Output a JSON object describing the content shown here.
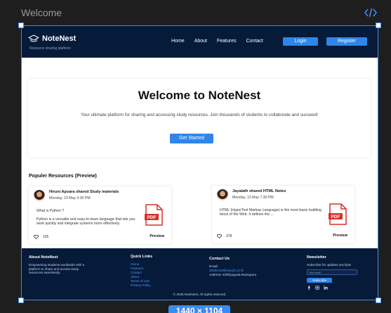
{
  "frame": {
    "title": "Welcome",
    "size_label": "1440 × 1104"
  },
  "nav": {
    "brand": "NoteNest",
    "tagline": "Resource sharing platform",
    "links": [
      "Home",
      "About",
      "Features",
      "Contact"
    ],
    "login": "Login",
    "register": "Register"
  },
  "hero": {
    "title": "Welcome to NoteNest",
    "subtitle": "Your ultimate platform for sharing and accessing study resources. Join thousands of students to collaborate and succeed!",
    "cta": "Get Started"
  },
  "resources": {
    "title": "Populer Resources (Preview)",
    "cards": [
      {
        "user": "Hiruni Apsara shared Study materials",
        "date": "Monday, 23 May 3:30 PM",
        "body": [
          "What is Python ?",
          "Python is a versatile and easy-to-learn language that lets you work quickly and integrate systems more effectively."
        ],
        "likes": "155",
        "preview": "Preview"
      },
      {
        "user": "Jayalath shared HTML Notes",
        "date": "Monday, 13 May 7:30 PM",
        "body": [
          "HTML (HyperText Markup Language) is the most basic building block of the Web. It defines the ..."
        ],
        "likes": "378",
        "preview": "Preview"
      }
    ]
  },
  "footer": {
    "about": {
      "title": "About NoteNest",
      "text": "Empowering students worldwide with a platform to share and access study resources seamlessly."
    },
    "quick_links": {
      "title": "Quick Links",
      "links": [
        "Home",
        "Features",
        "Contact",
        "About",
        "Terms of Use",
        "Privacy Policy"
      ]
    },
    "contact": {
      "title": "Contact Us",
      "email_label": "Email:",
      "email": "2020ict42@vau.jfn.ac.lk",
      "address": "Address: Ethiliyagoda,Ratnapura"
    },
    "newsletter": {
      "title": "Newsletter",
      "text": "Subscribe for updates and tips!",
      "placeholder": "Your email...",
      "button": "Subscribe",
      "socials": [
        "facebook-icon",
        "instagram-icon",
        "linkedin-icon"
      ]
    },
    "copyright": "© 2025 NoteNest. All rights reserved."
  },
  "colors": {
    "nav_bg": "#061a3a",
    "accent": "#2f86e8",
    "selection": "#3b8cf0",
    "pdf_red": "#d9302c"
  }
}
